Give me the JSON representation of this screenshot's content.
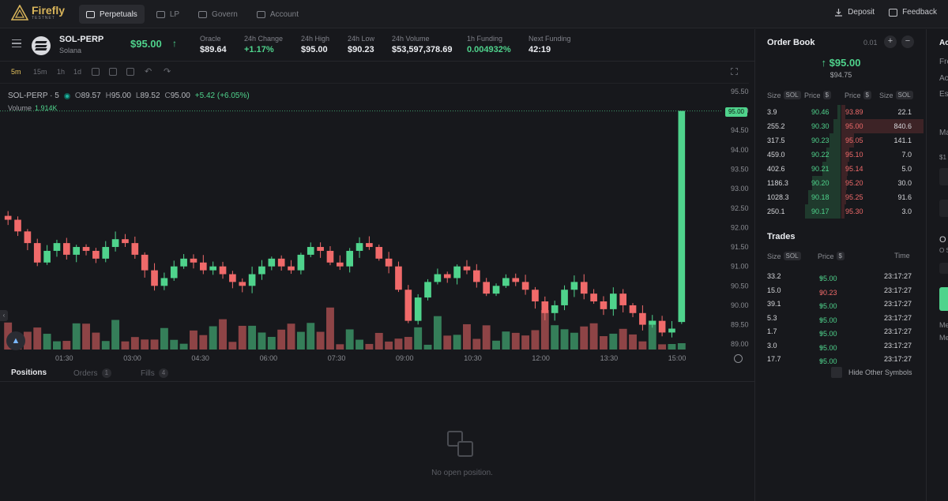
{
  "header": {
    "brand": "Firefly",
    "brand_sub": "TESTNET",
    "nav": [
      {
        "label": "Perpetuals",
        "active": true
      },
      {
        "label": "LP",
        "active": false
      },
      {
        "label": "Govern",
        "active": false
      },
      {
        "label": "Account",
        "active": false
      }
    ],
    "deposit": "Deposit",
    "feedback": "Feedback"
  },
  "market": {
    "symbol": "SOL-PERP",
    "name": "Solana",
    "price": "$95.00",
    "stats": [
      {
        "label": "Oracle",
        "value": "$89.64",
        "green": false
      },
      {
        "label": "24h Change",
        "value": "+1.17%",
        "green": true
      },
      {
        "label": "24h High",
        "value": "$95.00",
        "green": false
      },
      {
        "label": "24h Low",
        "value": "$90.23",
        "green": false
      },
      {
        "label": "24h Volume",
        "value": "$53,597,378.69",
        "green": false
      },
      {
        "label": "1h Funding",
        "value": "0.004932%",
        "green": true
      },
      {
        "label": "Next Funding",
        "value": "42:19",
        "green": false
      }
    ]
  },
  "chart": {
    "timeframes": [
      "5m",
      "15m",
      "1h",
      "1d"
    ],
    "active_timeframe": "5m",
    "legend_symbol": "SOL-PERP · 5",
    "o_label": "O",
    "o": "89.57",
    "h_label": "H",
    "h": "95.00",
    "l_label": "L",
    "l": "89.52",
    "c_label": "C",
    "c": "95.00",
    "change": "+5.42 (+6.05%)",
    "volume_label": "Volume",
    "volume_value": "1.914K",
    "last_price_tag": "95.00"
  },
  "chart_data": {
    "type": "candlestick",
    "title": "SOL-PERP · 5",
    "y_ticks": [
      "95.50",
      "95.00",
      "94.50",
      "94.00",
      "93.50",
      "93.00",
      "92.50",
      "92.00",
      "91.50",
      "91.00",
      "90.50",
      "90.00",
      "89.50",
      "89.00"
    ],
    "ylim": [
      88.7,
      95.6
    ],
    "x_ticks": [
      "01:30",
      "03:00",
      "04:30",
      "06:00",
      "07:30",
      "09:00",
      "10:30",
      "12:00",
      "13:30",
      "15:00"
    ],
    "ohlc_last": {
      "open": 89.57,
      "high": 95.0,
      "low": 89.52,
      "close": 95.0
    },
    "series_closes": [
      92.2,
      91.9,
      91.6,
      91.1,
      91.4,
      91.6,
      91.3,
      91.5,
      91.4,
      91.2,
      91.5,
      91.7,
      91.6,
      91.3,
      90.9,
      90.5,
      90.7,
      91.0,
      91.2,
      91.1,
      90.9,
      91.0,
      90.8,
      90.6,
      90.5,
      90.8,
      91.0,
      91.2,
      91.0,
      90.9,
      91.3,
      91.5,
      91.4,
      91.1,
      91.0,
      91.4,
      91.6,
      91.5,
      91.2,
      91.0,
      90.4,
      89.6,
      90.2,
      90.6,
      90.8,
      90.7,
      91.0,
      90.9,
      90.6,
      90.3,
      90.5,
      90.7,
      90.6,
      90.4,
      90.1,
      89.8,
      90.0,
      90.4,
      90.6,
      90.3,
      90.1,
      89.9,
      90.3,
      90.0,
      89.8,
      89.5,
      89.6,
      89.3,
      89.4,
      95.0
    ]
  },
  "bottom": {
    "tabs": [
      {
        "label": "Positions",
        "count": "",
        "active": true
      },
      {
        "label": "Orders",
        "count": "1",
        "active": false
      },
      {
        "label": "Fills",
        "count": "4",
        "active": false
      }
    ],
    "empty_text": "No open position."
  },
  "orderbook": {
    "title": "Order Book",
    "step": "0.01",
    "plus": "+",
    "minus": "−",
    "mid_price": "$95.00",
    "oracle_price": "$94.75",
    "head_size": "Size",
    "head_price": "Price",
    "sol_chip": "SOL",
    "usd_chip": "$",
    "rows": [
      {
        "bid_size": "3.9",
        "bid_price": "90.46",
        "ask_price": "93.89",
        "ask_size": "22.1",
        "bid_depth": 0.08,
        "ask_depth": 0.05
      },
      {
        "bid_size": "255.2",
        "bid_price": "90.30",
        "ask_price": "95.00",
        "ask_size": "840.6",
        "bid_depth": 0.2,
        "ask_depth": 1.0
      },
      {
        "bid_size": "317.5",
        "bid_price": "90.23",
        "ask_price": "95.05",
        "ask_size": "141.1",
        "bid_depth": 0.3,
        "ask_depth": 0.15
      },
      {
        "bid_size": "459.0",
        "bid_price": "90.22",
        "ask_price": "95.10",
        "ask_size": "7.0",
        "bid_depth": 0.4,
        "ask_depth": 0.1
      },
      {
        "bid_size": "402.6",
        "bid_price": "90.21",
        "ask_price": "95.14",
        "ask_size": "5.0",
        "bid_depth": 0.5,
        "ask_depth": 0.08
      },
      {
        "bid_size": "1186.3",
        "bid_price": "90.20",
        "ask_price": "95.20",
        "ask_size": "30.0",
        "bid_depth": 0.8,
        "ask_depth": 0.07
      },
      {
        "bid_size": "1028.3",
        "bid_price": "90.18",
        "ask_price": "95.25",
        "ask_size": "91.6",
        "bid_depth": 0.9,
        "ask_depth": 0.06
      },
      {
        "bid_size": "250.1",
        "bid_price": "90.17",
        "ask_price": "95.30",
        "ask_size": "3.0",
        "bid_depth": 1.0,
        "ask_depth": 0.04
      }
    ]
  },
  "trades": {
    "title": "Trades",
    "head_size": "Size",
    "sol_chip": "SOL",
    "head_price": "Price",
    "usd_chip": "$",
    "head_time": "Time",
    "rows": [
      {
        "size": "33.2",
        "price": "95.00",
        "side": "up",
        "time": "23:17:27"
      },
      {
        "size": "15.0",
        "price": "90.23",
        "side": "down",
        "time": "23:17:27"
      },
      {
        "size": "39.1",
        "price": "95.00",
        "side": "up",
        "time": "23:17:27"
      },
      {
        "size": "5.3",
        "price": "95.00",
        "side": "up",
        "time": "23:17:27"
      },
      {
        "size": "1.7",
        "price": "95.00",
        "side": "up",
        "time": "23:17:27"
      },
      {
        "size": "3.0",
        "price": "95.00",
        "side": "up",
        "time": "23:17:27"
      },
      {
        "size": "17.7",
        "price": "95.00",
        "side": "up",
        "time": "23:17:27"
      }
    ],
    "hide_other": "Hide Other Symbols"
  },
  "right_panel": {
    "labels": [
      "Ac",
      "Fre",
      "Ac",
      "Es",
      "Ma",
      "$1",
      "O",
      "O S",
      "Me",
      "Me"
    ]
  },
  "colors": {
    "green": "#4fd38c",
    "red": "#f06a6a",
    "accent": "#e7c45d",
    "bg": "#17181c"
  }
}
